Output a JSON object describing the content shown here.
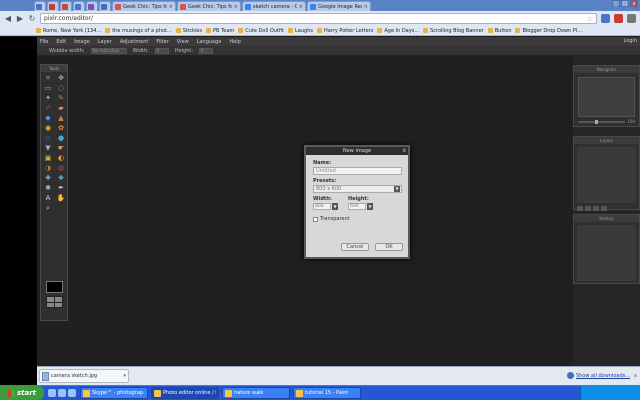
{
  "browser": {
    "tabs": [
      {
        "title": "",
        "favicon_color": "#4a74c9",
        "small": true
      },
      {
        "title": "",
        "favicon_color": "#cc3b2b",
        "small": true
      },
      {
        "title": "",
        "favicon_color": "#c54a3b",
        "small": true
      },
      {
        "title": "",
        "favicon_color": "#4a74c9",
        "small": true
      },
      {
        "title": "",
        "favicon_color": "#7e4fb0",
        "small": true
      },
      {
        "title": "",
        "favicon_color": "#3b6fc0",
        "small": true
      },
      {
        "title": "Geek Chic: Tips for the Tre...",
        "favicon_color": "#d9534f",
        "small": false
      },
      {
        "title": "Geek Chic: Tips for the Tre...",
        "favicon_color": "#d9534f",
        "small": false
      },
      {
        "title": "sketch camera - Google Se...",
        "favicon_color": "#3b82f6",
        "small": false
      },
      {
        "title": "Google Image Result for ht...",
        "favicon_color": "#3b82f6",
        "small": false
      }
    ],
    "url": "pixlr.com/editor/",
    "bookmarks": [
      "Rome, New York (134...",
      "the musings of a phot...",
      "Stickies",
      "PB Team",
      "Cute Doll Outfit",
      "Laughs",
      "Harry Potter Letters",
      "Age In Days...",
      "Scrolling Blog Banner",
      "Button",
      "Blogger Drop Down Pl..."
    ],
    "window_buttons": [
      "_",
      "□",
      "x"
    ]
  },
  "editor": {
    "menu": [
      "File",
      "Edit",
      "Image",
      "Layer",
      "Adjustment",
      "Filter",
      "View",
      "Language",
      "Help"
    ],
    "menu_right": "Login",
    "options": {
      "label1": "Wobble width:",
      "value1": "No restriction",
      "label2": "Width:",
      "value2": "0",
      "label3": "Height:",
      "value3": "0"
    },
    "tools_title": "Tools",
    "panels": {
      "navigator": "Navigator",
      "layers": "Layers",
      "history": "History",
      "zoom": "100"
    }
  },
  "dialog": {
    "title": "New image",
    "close": "x",
    "name_label": "Name:",
    "name_value": "Untitled",
    "presets_label": "Presets:",
    "presets_value": "800 x 600",
    "width_label": "Width:",
    "width_value": "800",
    "height_label": "Height:",
    "height_value": "600",
    "transparent_label": "Transparent",
    "cancel": "Cancel",
    "ok": "OK"
  },
  "downloads": {
    "file": "camera sketch.jpg",
    "show_all": "Show all downloads...",
    "close": "x"
  },
  "taskbar": {
    "start": "start",
    "tasks": [
      {
        "label": "Skype™ - photograp...",
        "active": false
      },
      {
        "label": "Photo editor online / f...",
        "active": true
      },
      {
        "label": "nature walk",
        "active": false
      },
      {
        "label": "tutorial 15 - Paint",
        "active": false
      }
    ]
  }
}
